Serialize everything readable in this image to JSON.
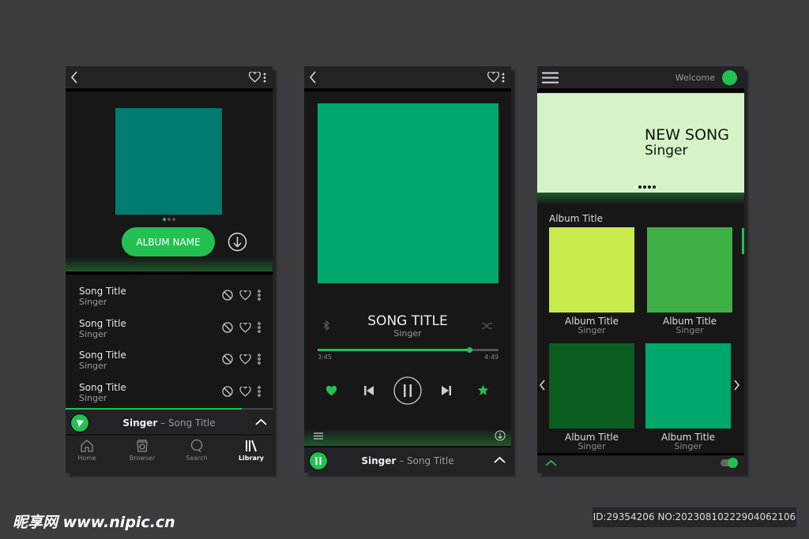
{
  "colors": {
    "accent": "#22c151",
    "background": "#3d3c41",
    "panel": "#171717"
  },
  "screen_album": {
    "topbar": {
      "back_icon": "chevron-left-icon",
      "fav_icon": "heart-icon",
      "more_icon": "more-vertical-icon"
    },
    "cover_color": "#007b6f",
    "pager": {
      "count": 3,
      "active": 0
    },
    "album_button": "ALBUM NAME",
    "download_icon": "download-circle-icon",
    "songs": [
      {
        "title": "Song Title",
        "singer": "Singer"
      },
      {
        "title": "Song Title",
        "singer": "Singer"
      },
      {
        "title": "Song Title",
        "singer": "Singer"
      },
      {
        "title": "Song Title",
        "singer": "Singer"
      }
    ],
    "mini_player": {
      "singer": "Singer",
      "separator": " – ",
      "song": "Song Title",
      "progress": 0.85
    },
    "nav": [
      {
        "label": "Home",
        "icon": "home-icon"
      },
      {
        "label": "Browser",
        "icon": "browser-icon"
      },
      {
        "label": "Search",
        "icon": "search-icon"
      },
      {
        "label": "Library",
        "icon": "library-icon",
        "active": true
      }
    ]
  },
  "screen_player": {
    "cover_color": "#00a86b",
    "title": "SONG TITLE",
    "singer": "Singer",
    "progress": 0.84,
    "time_elapsed": "3:45",
    "time_total": "4:49",
    "mini_player": {
      "singer": "Singer",
      "separator": " – ",
      "song": "Song Title"
    }
  },
  "screen_home": {
    "welcome": "Welcome",
    "banner": {
      "title": "NEW SONG",
      "singer": "Singer",
      "pager": {
        "count": 5,
        "active": 0
      }
    },
    "section_title": "Album Title",
    "albums": [
      {
        "title": "Album Title",
        "singer": "Singer",
        "color": "#c8ea4a"
      },
      {
        "title": "Album Title",
        "singer": "Singer",
        "color": "#3fb044"
      },
      {
        "title": "Album Title",
        "singer": "Singer",
        "color": "#0b5e1f"
      },
      {
        "title": "Album Title",
        "singer": "Singer",
        "color": "#00a86b"
      }
    ]
  },
  "watermark": {
    "left": "昵享网 www.nipic.cn",
    "right": "ID:29354206 NO:20230810222904062106"
  }
}
